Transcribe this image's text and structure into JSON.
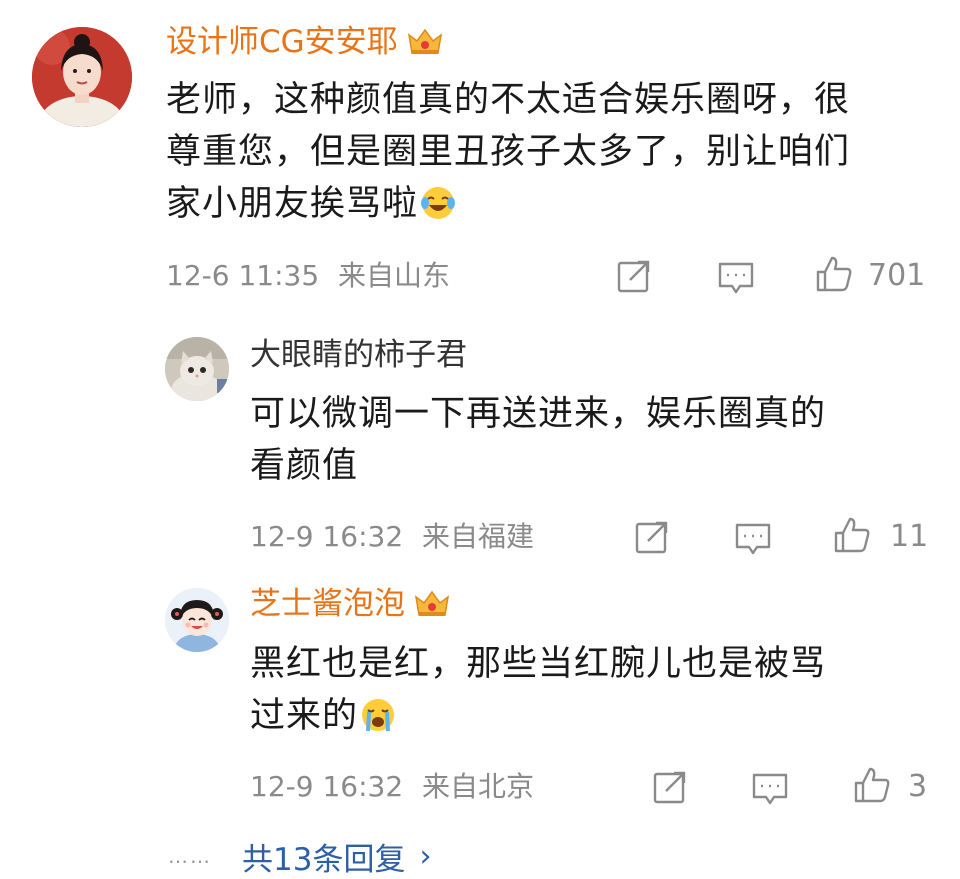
{
  "comments": [
    {
      "username": "设计师CG安安耶",
      "vip": true,
      "text_lines": [
        "老师，这种颜值真的不太适合娱乐圈呀，很",
        "尊重您，但是圈里丑孩子太多了，别让咱们",
        "家小朋友挨骂啦"
      ],
      "emoji": "laugh-cry-emoji",
      "time": "12-6 11:35",
      "location": "来自山东",
      "likes": "701"
    },
    {
      "username": "大眼睛的柿子君",
      "vip": false,
      "text_lines": [
        "可以微调一下再送进来，娱乐圈真的",
        "看颜值"
      ],
      "time": "12-9 16:32",
      "location": "来自福建",
      "likes": "11"
    },
    {
      "username": "芝士酱泡泡",
      "vip": true,
      "text_lines": [
        "黑红也是红，那些当红腕儿也是被骂",
        "过来的"
      ],
      "emoji": "crying-emoji",
      "time": "12-9 16:32",
      "location": "来自北京",
      "likes": "3"
    }
  ],
  "footer": {
    "dots": "……",
    "more_replies": "共13条回复",
    "arrow": "›"
  },
  "colors": {
    "vip_name": "#e87417",
    "link": "#2d5fa6",
    "meta": "#8a8a8a"
  },
  "icons": [
    "vip-crown-icon",
    "share-icon",
    "comment-icon",
    "like-icon"
  ]
}
